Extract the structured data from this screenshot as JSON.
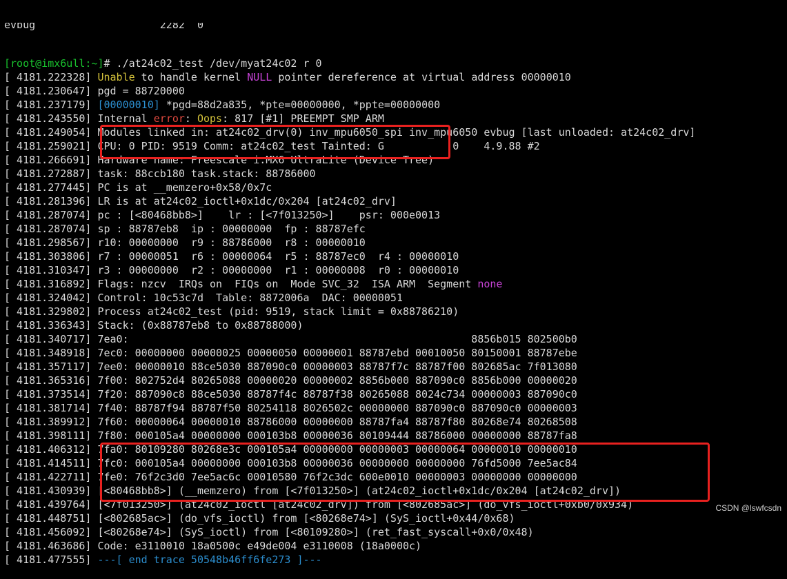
{
  "terminal": {
    "top_partial_line": [
      {
        "text": "evbug                    2282  0",
        "color": "#d9d9d9"
      }
    ],
    "lines": [
      [
        {
          "text": "[root@imx6ull:~]",
          "color": "#19c22e"
        },
        {
          "text": "# ./at24c02_test /dev/myat24c02 r 0",
          "color": "#d9d9d9"
        }
      ],
      [
        {
          "text": "[ 4181.222328] ",
          "color": "#d9d9d9"
        },
        {
          "text": "Unable",
          "color": "#d3c13b"
        },
        {
          "text": " to handle kernel ",
          "color": "#d9d9d9"
        },
        {
          "text": "NULL",
          "color": "#c944d8"
        },
        {
          "text": " pointer dereference at virtual address 00000010",
          "color": "#d9d9d9"
        }
      ],
      [
        {
          "text": "[ 4181.230647] pgd = 88720000",
          "color": "#d9d9d9"
        }
      ],
      [
        {
          "text": "[ 4181.237179] ",
          "color": "#d9d9d9"
        },
        {
          "text": "[00000010]",
          "color": "#2c8fd0"
        },
        {
          "text": " *pgd=88d2a835, *pte=00000000, *ppte=00000000",
          "color": "#d9d9d9"
        }
      ],
      [
        {
          "text": "[ 4181.243550] Internal ",
          "color": "#d9d9d9"
        },
        {
          "text": "error",
          "color": "#e0493f"
        },
        {
          "text": ": ",
          "color": "#d9d9d9"
        },
        {
          "text": "Oops",
          "color": "#d3c13b"
        },
        {
          "text": ": 817 [#1] PREEMPT SMP ARM",
          "color": "#d9d9d9"
        }
      ],
      [
        {
          "text": "[ 4181.249054] Modules linked in: at24c02_drv(0) inv_mpu6050_spi inv_mpu6050 evbug [last unloaded: at24c02_drv]",
          "color": "#d9d9d9"
        }
      ],
      [
        {
          "text": "[ 4181.259021] CPU: 0 PID: 9519 Comm: at24c02_test Tainted: G           0    4.9.88 #2",
          "color": "#d9d9d9"
        }
      ],
      [
        {
          "text": "[ 4181.266691] Hardware name: Freescale i.MX6 UltraLite (Device Tree)",
          "color": "#d9d9d9"
        }
      ],
      [
        {
          "text": "[ 4181.272887] task: 88ccb180 task.stack: 88786000",
          "color": "#d9d9d9"
        }
      ],
      [
        {
          "text": "[ 4181.277445] PC is at __memzero+0x58/0x7c",
          "color": "#d9d9d9"
        }
      ],
      [
        {
          "text": "[ 4181.281396] LR is at at24c02_ioctl+0x1dc/0x204 [at24c02_drv]",
          "color": "#d9d9d9"
        }
      ],
      [
        {
          "text": "[ 4181.287074] pc : [<80468bb8>]    lr : [<7f013250>]    psr: 000e0013",
          "color": "#d9d9d9"
        }
      ],
      [
        {
          "text": "[ 4181.287074] sp : 88787eb8  ip : 00000000  fp : 88787efc",
          "color": "#d9d9d9"
        }
      ],
      [
        {
          "text": "[ 4181.298567] r10: 00000000  r9 : 88786000  r8 : 00000010",
          "color": "#d9d9d9"
        }
      ],
      [
        {
          "text": "[ 4181.303806] r7 : 00000051  r6 : 00000064  r5 : 88787ec0  r4 : 00000010",
          "color": "#d9d9d9"
        }
      ],
      [
        {
          "text": "[ 4181.310347] r3 : 00000000  r2 : 00000000  r1 : 00000008  r0 : 00000010",
          "color": "#d9d9d9"
        }
      ],
      [
        {
          "text": "[ 4181.316892] Flags: nzcv  IRQs on  FIQs on  Mode SVC_32  ISA ARM  Segment ",
          "color": "#d9d9d9"
        },
        {
          "text": "none",
          "color": "#c944d8"
        }
      ],
      [
        {
          "text": "[ 4181.324042] Control: 10c53c7d  Table: 8872006a  DAC: 00000051",
          "color": "#d9d9d9"
        }
      ],
      [
        {
          "text": "[ 4181.329802] Process at24c02_test (pid: 9519, stack limit = 0x88786210)",
          "color": "#d9d9d9"
        }
      ],
      [
        {
          "text": "[ 4181.336343] Stack: (0x88787eb8 to 0x88788000)",
          "color": "#d9d9d9"
        }
      ],
      [
        {
          "text": "[ 4181.340717] 7ea0:                                                       8856b015 802500b0",
          "color": "#d9d9d9"
        }
      ],
      [
        {
          "text": "[ 4181.348918] 7ec0: 00000000 00000025 00000050 00000001 88787ebd 00010050 80150001 88787ebe",
          "color": "#d9d9d9"
        }
      ],
      [
        {
          "text": "[ 4181.357117] 7ee0: 00000010 88ce5030 887090c0 00000003 88787f7c 88787f00 802685ac 7f013080",
          "color": "#d9d9d9"
        }
      ],
      [
        {
          "text": "[ 4181.365316] 7f00: 802752d4 80265088 00000020 00000002 8856b000 887090c0 8856b000 00000020",
          "color": "#d9d9d9"
        }
      ],
      [
        {
          "text": "[ 4181.373514] 7f20: 887090c8 88ce5030 88787f4c 88787f38 80265088 8024c734 00000003 887090c0",
          "color": "#d9d9d9"
        }
      ],
      [
        {
          "text": "[ 4181.381714] 7f40: 88787f94 88787f50 80254118 8026502c 00000000 887090c0 887090c0 00000003",
          "color": "#d9d9d9"
        }
      ],
      [
        {
          "text": "[ 4181.389912] 7f60: 00000064 00000010 88786000 00000000 88787fa4 88787f80 80268e74 80268508",
          "color": "#d9d9d9"
        }
      ],
      [
        {
          "text": "[ 4181.398111] 7f80: 000105a4 00000000 000103b8 00000036 80109444 88786000 00000000 88787fa8",
          "color": "#d9d9d9"
        }
      ],
      [
        {
          "text": "[ 4181.406312] 7fa0: 80109280 80268e3c 000105a4 00000000 00000003 00000064 00000010 00000010",
          "color": "#d9d9d9"
        }
      ],
      [
        {
          "text": "[ 4181.414511] 7fc0: 000105a4 00000000 000103b8 00000036 00000000 00000000 76fd5000 7ee5ac84",
          "color": "#d9d9d9"
        }
      ],
      [
        {
          "text": "[ 4181.422711] 7fe0: 76f2c3d0 7ee5ac6c 00010580 76f2c3dc 600e0010 00000003 00000000 00000000",
          "color": "#d9d9d9"
        }
      ],
      [
        {
          "text": "[ 4181.430939] [<80468bb8>] (__memzero) from [<7f013250>] (at24c02_ioctl+0x1dc/0x204 [at24c02_drv])",
          "color": "#d9d9d9"
        }
      ],
      [
        {
          "text": "[ 4181.439764] [<7f013250>] (at24c02_ioctl [at24c02_drv]) from [<802685ac>] (do_vfs_ioctl+0xb0/0x934)",
          "color": "#d9d9d9"
        }
      ],
      [
        {
          "text": "[ 4181.448751] [<802685ac>] (do_vfs_ioctl) from [<80268e74>] (SyS_ioctl+0x44/0x68)",
          "color": "#d9d9d9"
        }
      ],
      [
        {
          "text": "[ 4181.456092] [<80268e74>] (SyS_ioctl) from [<80109280>] (ret_fast_syscall+0x0/0x48)",
          "color": "#d9d9d9"
        }
      ],
      [
        {
          "text": "[ 4181.463686] Code: e3110010 18a0500c e49de004 e3110008 (18a0000c)",
          "color": "#d9d9d9"
        }
      ],
      [
        {
          "text": "[ 4181.477555] ",
          "color": "#d9d9d9"
        },
        {
          "text": "---[ end trace 50548b46ff6fe273 ]---",
          "color": "#2c8fd0"
        }
      ]
    ]
  },
  "highlight_color": "#e8211f",
  "watermark": "CSDN @lswfcsdn"
}
